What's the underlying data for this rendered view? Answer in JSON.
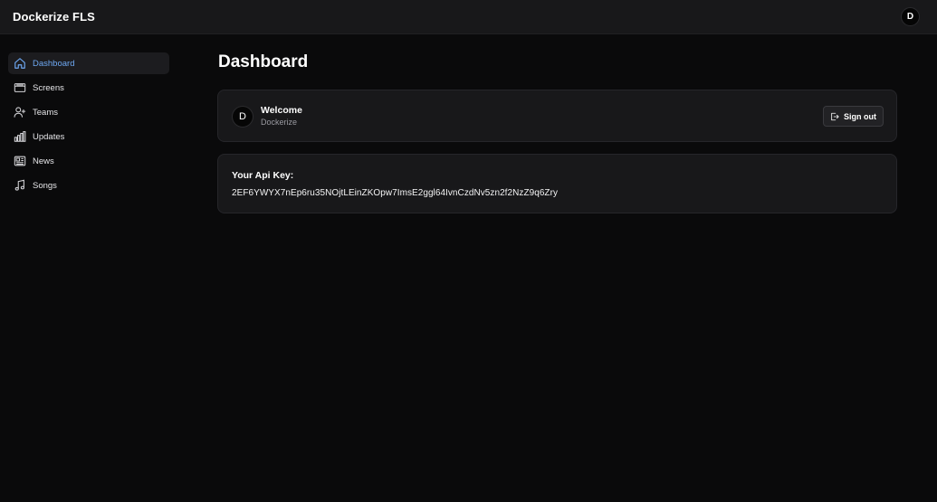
{
  "app": {
    "title": "Dockerize FLS",
    "user_initial": "D"
  },
  "sidebar": {
    "items": [
      {
        "label": "Dashboard",
        "icon": "home-icon",
        "active": true
      },
      {
        "label": "Screens",
        "icon": "screens-icon",
        "active": false
      },
      {
        "label": "Teams",
        "icon": "user-plus-icon",
        "active": false
      },
      {
        "label": "Updates",
        "icon": "bar-chart-icon",
        "active": false
      },
      {
        "label": "News",
        "icon": "newspaper-icon",
        "active": false
      },
      {
        "label": "Songs",
        "icon": "music-note-icon",
        "active": false
      }
    ]
  },
  "main": {
    "title": "Dashboard",
    "welcome": {
      "avatar_initial": "D",
      "title": "Welcome",
      "subtitle": "Dockerize",
      "sign_out_label": "Sign out",
      "sign_out_icon": "sign-out-icon"
    },
    "api": {
      "label": "Your Api Key:",
      "key": "2EF6YWYX7nEp6ru35NOjtLEinZKOpw7ImsE2ggl64IvnCzdNv5zn2f2NzZ9q6Zry"
    }
  },
  "colors": {
    "background": "#0a0a0b",
    "topbar": "#18181a",
    "card": "#18181a",
    "accent": "#6ea8f2",
    "muted_text": "#9a9aa1"
  }
}
